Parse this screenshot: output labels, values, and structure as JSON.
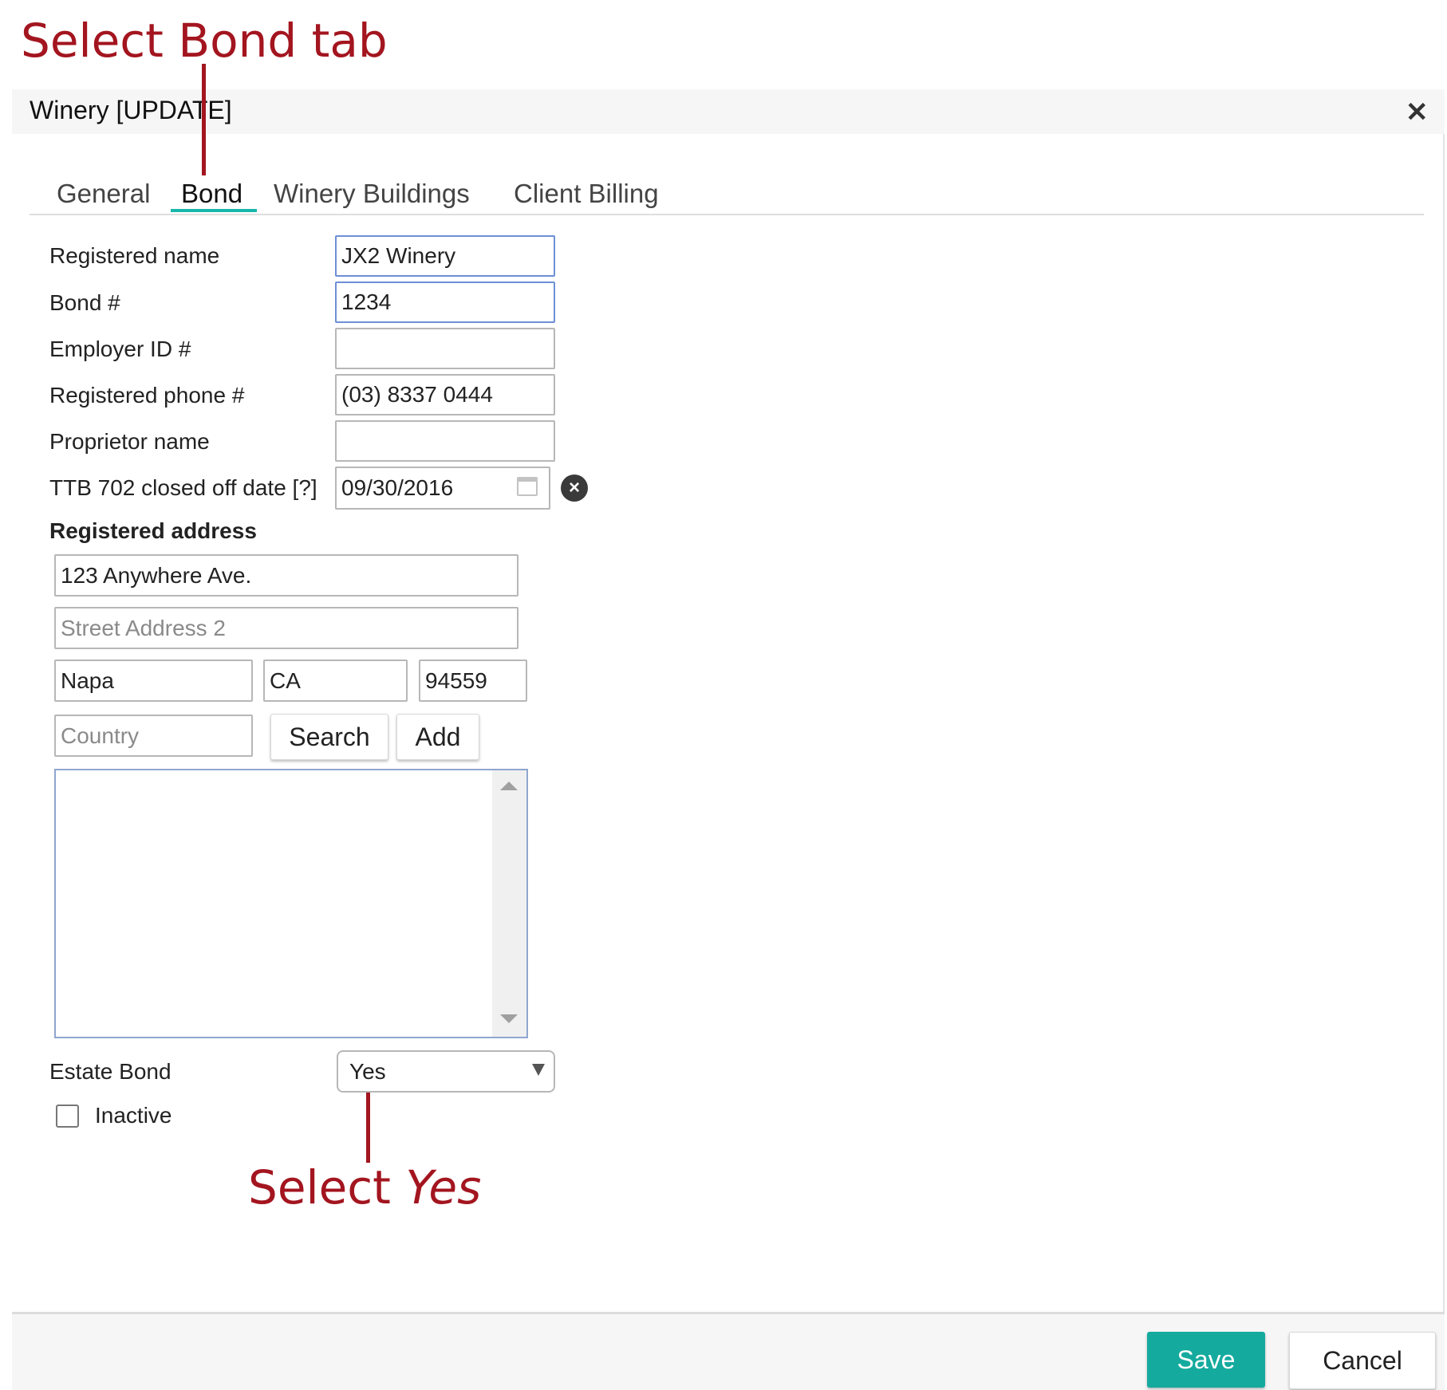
{
  "annotations": {
    "top": "Select Bond tab",
    "bottom_prefix": "Select",
    "bottom_emphasis": "Yes"
  },
  "dialog": {
    "title": "Winery [UPDATE]",
    "close_icon": "close-icon"
  },
  "tabs": [
    {
      "label": "General",
      "active": false
    },
    {
      "label": "Bond",
      "active": true
    },
    {
      "label": "Winery Buildings",
      "active": false
    },
    {
      "label": "Client Billing",
      "active": false
    }
  ],
  "form": {
    "registered_name": {
      "label": "Registered name",
      "value": "JX2 Winery"
    },
    "bond_number": {
      "label": "Bond #",
      "value": "1234"
    },
    "employer_id": {
      "label": "Employer ID #",
      "value": ""
    },
    "registered_phone": {
      "label": "Registered phone #",
      "value": "(03) 8337 0444"
    },
    "proprietor_name": {
      "label": "Proprietor name",
      "value": ""
    },
    "ttb_date": {
      "label": "TTB 702 closed off date [?]",
      "value": "09/30/2016"
    },
    "address": {
      "label": "Registered address",
      "street1": "123 Anywhere Ave.",
      "street2_placeholder": "Street Address 2",
      "city": "Napa",
      "state": "CA",
      "zip": "94559",
      "country_placeholder": "Country",
      "search_label": "Search",
      "add_label": "Add"
    },
    "estate_bond": {
      "label": "Estate Bond",
      "selected": "Yes"
    },
    "inactive": {
      "label": "Inactive",
      "checked": false
    }
  },
  "footer": {
    "save_label": "Save",
    "cancel_label": "Cancel"
  },
  "colors": {
    "annotation": "#a3151f",
    "accent": "#15aa9e",
    "tab_underline": "#18b7ab"
  }
}
